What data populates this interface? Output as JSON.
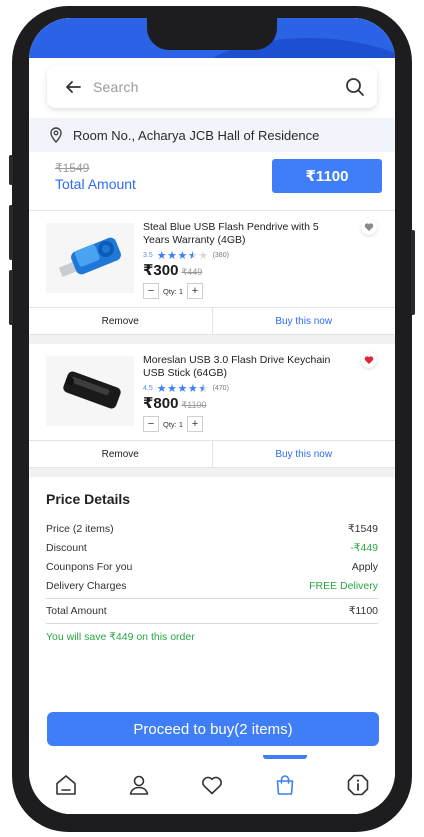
{
  "search": {
    "placeholder": "Search"
  },
  "address": {
    "text": "Room No., Acharya JCB Hall of Residence"
  },
  "summary": {
    "old_total": "₹1549",
    "total_label": "Total Amount",
    "pay_button": "₹1100"
  },
  "products": [
    {
      "title": "Steal Blue USB Flash Pendrive with 5 Years Warranty (4GB)",
      "rating_value": "3.5",
      "rating_count": "(380)",
      "stars_filled": 3.5,
      "price": "₹300",
      "mrp": "₹449",
      "qty_label": "Qty: 1",
      "wishlisted": false,
      "remove_label": "Remove",
      "buy_label": "Buy this now"
    },
    {
      "title": "Moreslan USB 3.0 Flash Drive Keychain USB Stick (64GB)",
      "rating_value": "4.5",
      "rating_count": "(470)",
      "stars_filled": 4.5,
      "price": "₹800",
      "mrp": "₹1100",
      "qty_label": "Qty: 1",
      "wishlisted": true,
      "remove_label": "Remove",
      "buy_label": "Buy this now"
    }
  ],
  "price_details": {
    "title": "Price Details",
    "rows": [
      {
        "label": "Price (2 items)",
        "value": "₹1549"
      },
      {
        "label": "Discount",
        "value": "-₹449"
      },
      {
        "label": "Counpons For you",
        "value": "Apply"
      },
      {
        "label": "Delivery Charges",
        "value": "FREE Delivery"
      }
    ],
    "total_label": "Total Amount",
    "total_value": "₹1100",
    "savings_text": "You will save ₹449 on this order"
  },
  "proceed_button": "Proceed to buy(2 items)",
  "nav": {
    "items": [
      "home-icon",
      "profile-icon",
      "heart-icon",
      "bag-icon",
      "info-icon"
    ],
    "active": "bag-icon"
  },
  "colors": {
    "accent": "#3f7ef6",
    "link": "#2e6cf0",
    "green": "#2aa745",
    "wishlist": "#e0243a"
  }
}
